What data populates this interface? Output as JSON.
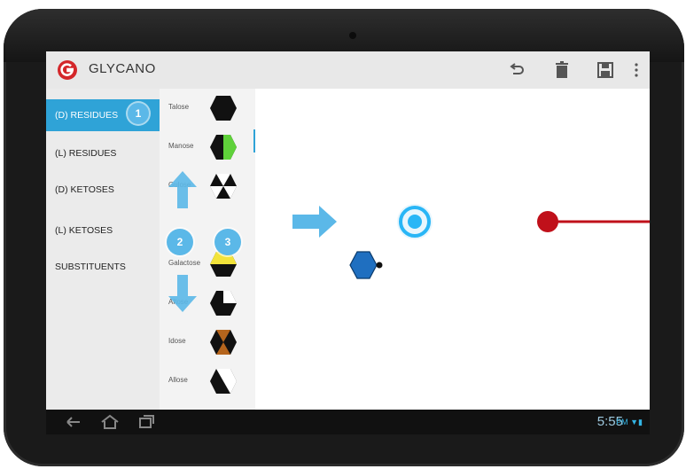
{
  "app": {
    "title": "GLYCANO"
  },
  "sidebar": {
    "items": [
      {
        "label": "(D) RESIDUES",
        "active": true,
        "badge": "1"
      },
      {
        "label": "(L) RESIDUES",
        "active": false
      },
      {
        "label": "(D) KETOSES",
        "active": false
      },
      {
        "label": "(L) KETOSES",
        "active": false
      },
      {
        "label": "SUBSTITUENTS",
        "active": false
      }
    ]
  },
  "residues": [
    {
      "label": "Talose",
      "icon": "black-hexagon"
    },
    {
      "label": "Manose",
      "icon": "green-split-hexagon"
    },
    {
      "label": "Gulose",
      "icon": "cross-hexagon"
    },
    {
      "label": "",
      "icon": ""
    },
    {
      "label": "Galactose",
      "icon": "yellow-hexagon"
    },
    {
      "label": "Altose",
      "icon": "quarter-hexagon"
    },
    {
      "label": "Idose",
      "icon": "brown-hexagon"
    },
    {
      "label": "Allose",
      "icon": "diagonal-hexagon"
    }
  ],
  "tutorial": {
    "badge2": "2",
    "badge3": "3"
  },
  "status": {
    "time": "5:55",
    "indicators": "PM ▼▮"
  },
  "colors": {
    "accent": "#2fa3d7",
    "badge": "#5bb8e8",
    "red_dot": "#c0101a",
    "hex_blue": "#1f6fc0"
  }
}
